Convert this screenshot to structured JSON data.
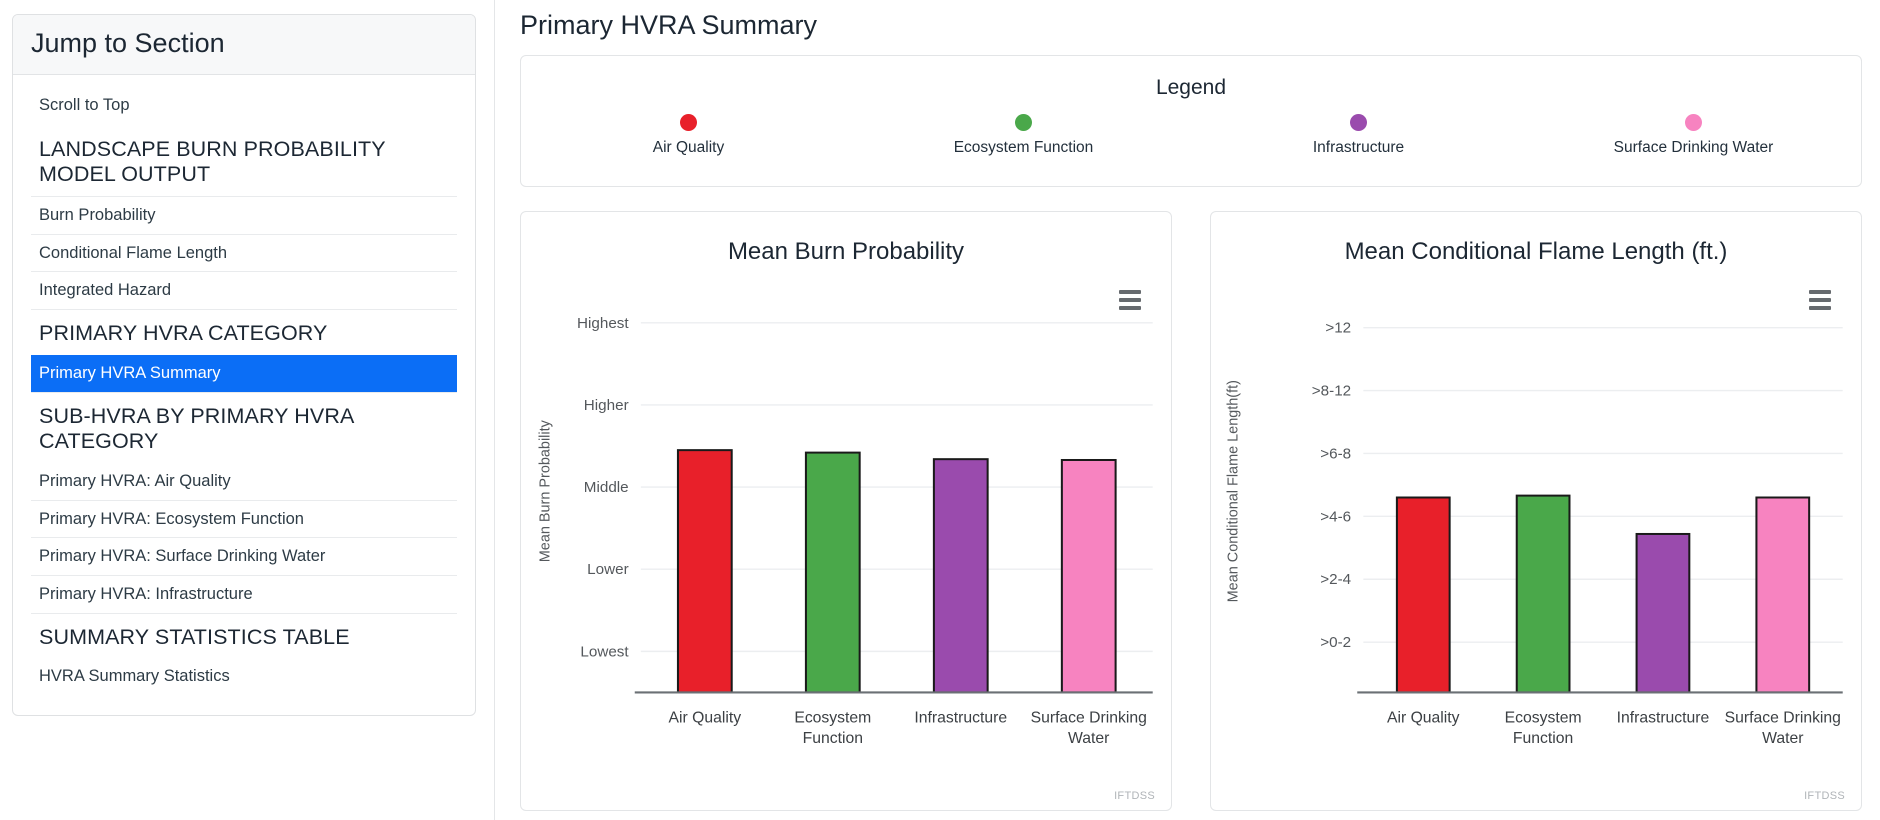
{
  "sidebar": {
    "header": "Jump to Section",
    "items": [
      {
        "type": "link",
        "label": "Scroll to Top",
        "active": false,
        "divider": false
      },
      {
        "type": "group",
        "label": "LANDSCAPE BURN PROBABILITY MODEL OUTPUT",
        "active": false,
        "divider": false
      },
      {
        "type": "link",
        "label": "Burn Probability",
        "active": false,
        "divider": true
      },
      {
        "type": "link",
        "label": "Conditional Flame Length",
        "active": false,
        "divider": true
      },
      {
        "type": "link",
        "label": "Integrated Hazard",
        "active": false,
        "divider": true
      },
      {
        "type": "group",
        "label": "PRIMARY HVRA CATEGORY",
        "active": false,
        "divider": true
      },
      {
        "type": "link",
        "label": "Primary HVRA Summary",
        "active": true,
        "divider": false
      },
      {
        "type": "group",
        "label": "SUB-HVRA BY PRIMARY HVRA CATEGORY",
        "active": false,
        "divider": true
      },
      {
        "type": "link",
        "label": "Primary HVRA: Air Quality",
        "active": false,
        "divider": false
      },
      {
        "type": "link",
        "label": "Primary HVRA: Ecosystem Function",
        "active": false,
        "divider": true
      },
      {
        "type": "link",
        "label": "Primary HVRA: Surface Drinking Water",
        "active": false,
        "divider": true
      },
      {
        "type": "link",
        "label": "Primary HVRA: Infrastructure",
        "active": false,
        "divider": true
      },
      {
        "type": "group",
        "label": "SUMMARY STATISTICS TABLE",
        "active": false,
        "divider": true
      },
      {
        "type": "link",
        "label": "HVRA Summary Statistics",
        "active": false,
        "divider": false
      }
    ]
  },
  "page": {
    "title": "Primary HVRA Summary"
  },
  "legend": {
    "title": "Legend",
    "items": [
      {
        "label": "Air Quality",
        "color": "#e8202a"
      },
      {
        "label": "Ecosystem Function",
        "color": "#4aa84a"
      },
      {
        "label": "Infrastructure",
        "color": "#9a4bad"
      },
      {
        "label": "Surface Drinking Water",
        "color": "#f783c0"
      }
    ]
  },
  "menu_icon": "hamburger-menu-icon",
  "watermark": "IFTDSS",
  "chart_data": [
    {
      "id": "mean-burn-probability",
      "type": "bar",
      "title": "Mean Burn Probability",
      "xlabel": "",
      "ylabel": "Mean Burn Probability",
      "categories": [
        "Air Quality",
        "Ecosystem Function",
        "Infrastructure",
        "Surface Drinking Water"
      ],
      "tick_labels": [
        "Lowest",
        "Lower",
        "Middle",
        "Higher",
        "Highest"
      ],
      "tick_values": [
        1,
        2,
        3,
        4,
        5
      ],
      "ylim": [
        0.5,
        5.4
      ],
      "grid": true,
      "legend_position": "top-external",
      "values": [
        3.45,
        3.42,
        3.34,
        3.33
      ],
      "colors": [
        "#e8202a",
        "#4aa84a",
        "#9a4bad",
        "#f783c0"
      ]
    },
    {
      "id": "mean-conditional-flame-length",
      "type": "bar",
      "title": "Mean Conditional Flame Length (ft.)",
      "xlabel": "",
      "ylabel": "Mean Conditional Flame Length(ft)",
      "categories": [
        "Air Quality",
        "Ecosystem Function",
        "Infrastructure",
        "Surface Drinking Water"
      ],
      "tick_labels": [
        ">0-2",
        ">2-4",
        ">4-6",
        ">6-8",
        ">8-12",
        ">12"
      ],
      "tick_values": [
        1,
        2,
        3,
        4,
        5,
        6
      ],
      "ylim": [
        0.2,
        6.6
      ],
      "grid": true,
      "legend_position": "top-external",
      "values": [
        3.3,
        3.33,
        2.72,
        3.3
      ],
      "colors": [
        "#e8202a",
        "#4aa84a",
        "#9a4bad",
        "#f783c0"
      ]
    }
  ]
}
